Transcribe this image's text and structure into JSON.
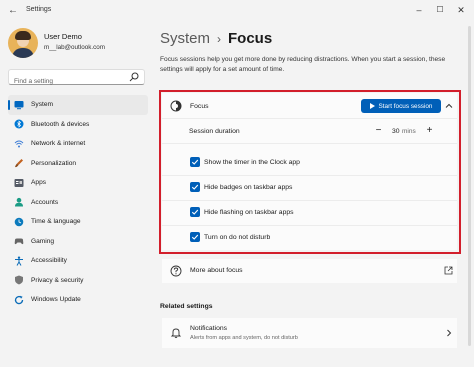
{
  "window": {
    "title": "Settings",
    "back_glyph": "←",
    "min_glyph": "–",
    "max_glyph": "☐",
    "close_glyph": "✕"
  },
  "user": {
    "name": "User Demo",
    "email": "m__lab@outlook.com"
  },
  "search": {
    "placeholder": "Find a setting"
  },
  "sidebar": {
    "items": [
      {
        "label": "System",
        "icon": "system-icon",
        "color": "#0067c0",
        "active": true
      },
      {
        "label": "Bluetooth & devices",
        "icon": "bluetooth-icon",
        "color": "#0078d4"
      },
      {
        "label": "Network & internet",
        "icon": "network-icon",
        "color": "#3a7bd5"
      },
      {
        "label": "Personalization",
        "icon": "brush-icon",
        "color": "#c2611d"
      },
      {
        "label": "Apps",
        "icon": "apps-icon",
        "color": "#555b66"
      },
      {
        "label": "Accounts",
        "icon": "accounts-icon",
        "color": "#1b9c85"
      },
      {
        "label": "Time & language",
        "icon": "clock-icon",
        "color": "#0b7abd"
      },
      {
        "label": "Gaming",
        "icon": "gaming-icon",
        "color": "#666"
      },
      {
        "label": "Accessibility",
        "icon": "accessibility-icon",
        "color": "#0b6cb8"
      },
      {
        "label": "Privacy & security",
        "icon": "shield-icon",
        "color": "#777"
      },
      {
        "label": "Windows Update",
        "icon": "update-icon",
        "color": "#0b6cb8"
      }
    ]
  },
  "breadcrumb": {
    "parent": "System",
    "separator": "›",
    "current": "Focus"
  },
  "description": "Focus sessions help you get more done by reducing distractions. When you start a session, these settings will apply for a set amount of time.",
  "focus": {
    "title": "Focus",
    "start_button": "Start focus session",
    "session": {
      "label": "Session duration",
      "minus": "−",
      "value": "30",
      "unit": "mins",
      "plus": "+"
    },
    "options": [
      {
        "label": "Show the timer in the Clock app",
        "checked": true
      },
      {
        "label": "Hide badges on taskbar apps",
        "checked": true
      },
      {
        "label": "Hide flashing on taskbar apps",
        "checked": true
      },
      {
        "label": "Turn on do not disturb",
        "checked": true
      }
    ]
  },
  "more": {
    "label": "More about focus"
  },
  "related": {
    "heading": "Related settings",
    "notifications": {
      "title": "Notifications",
      "subtitle": "Alerts from apps and system, do not disturb"
    }
  },
  "colors": {
    "accent": "#005fb8",
    "highlight_border": "#d21e2b"
  }
}
